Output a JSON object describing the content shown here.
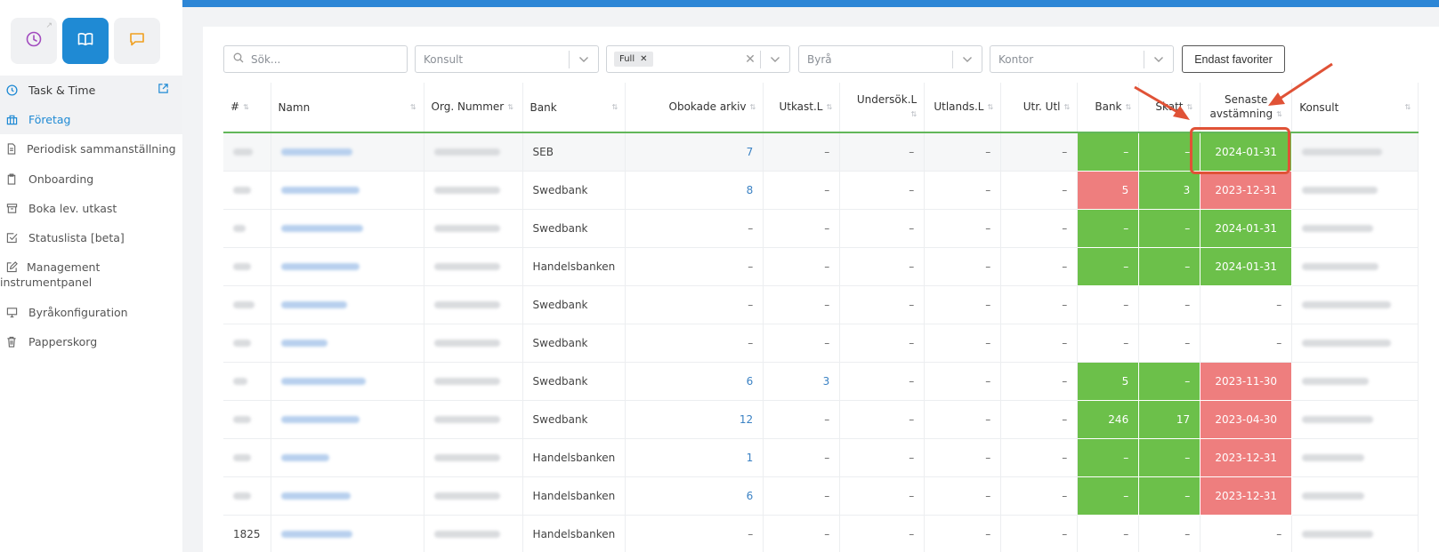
{
  "sidebar": {
    "top_icons": [
      "clock-icon",
      "book-icon",
      "chat-icon"
    ],
    "items": [
      {
        "label": "Task & Time",
        "icon": "clock-icon",
        "external": true
      },
      {
        "label": "Företag",
        "icon": "building-icon"
      },
      {
        "label": "Periodisk sammanställning",
        "icon": "document-icon"
      },
      {
        "label": "Onboarding",
        "icon": "clipboard-icon"
      },
      {
        "label": "Boka lev. utkast",
        "icon": "archive-icon"
      },
      {
        "label": "Statuslista [beta]",
        "icon": "checkbox-icon"
      },
      {
        "label": "Management instrumentpanel",
        "icon": "edit-icon"
      },
      {
        "label": "Byråkonfiguration",
        "icon": "monitor-icon"
      },
      {
        "label": "Papperskorg",
        "icon": "trash-icon"
      }
    ]
  },
  "filters": {
    "search_placeholder": "Sök...",
    "konsult_placeholder": "Konsult",
    "full_chip": "Full",
    "byra_placeholder": "Byrå",
    "kontor_placeholder": "Kontor",
    "favorites_button": "Endast favoriter"
  },
  "table": {
    "headers": {
      "num": "#",
      "namn": "Namn",
      "org": "Org. Nummer",
      "bank": "Bank",
      "obokade": "Obokade arkiv",
      "utkast": "Utkast.L",
      "undersok": "Undersök.L",
      "utlands": "Utlands.L",
      "utrutl": "Utr. Utl",
      "bank2": "Bank",
      "skatt": "Skatt",
      "senaste1": "Senaste",
      "senaste2": "avstämning",
      "konsult": "Konsult"
    },
    "rows": [
      {
        "bank": "SEB",
        "obokade": "7",
        "utkast": "–",
        "undersok": "–",
        "utlands": "–",
        "utrutl": "–",
        "bankv": "–",
        "skatt": "–",
        "senaste": "2024-01-31",
        "bank_status": "green",
        "skatt_status": "green",
        "date_status": "green"
      },
      {
        "bank": "Swedbank",
        "obokade": "8",
        "utkast": "–",
        "undersok": "–",
        "utlands": "–",
        "utrutl": "–",
        "bankv": "5",
        "skatt": "3",
        "senaste": "2023-12-31",
        "bank_status": "red",
        "skatt_status": "green",
        "date_status": "red"
      },
      {
        "bank": "Swedbank",
        "obokade": "–",
        "utkast": "–",
        "undersok": "–",
        "utlands": "–",
        "utrutl": "–",
        "bankv": "–",
        "skatt": "–",
        "senaste": "2024-01-31",
        "bank_status": "green",
        "skatt_status": "green",
        "date_status": "green"
      },
      {
        "bank": "Handelsbanken",
        "obokade": "–",
        "utkast": "–",
        "undersok": "–",
        "utlands": "–",
        "utrutl": "–",
        "bankv": "–",
        "skatt": "–",
        "senaste": "2024-01-31",
        "bank_status": "green",
        "skatt_status": "green",
        "date_status": "green"
      },
      {
        "bank": "Swedbank",
        "obokade": "–",
        "utkast": "–",
        "undersok": "–",
        "utlands": "–",
        "utrutl": "–",
        "bankv": "–",
        "skatt": "–",
        "senaste": "–",
        "bank_status": "none",
        "skatt_status": "none",
        "date_status": "none"
      },
      {
        "bank": "Swedbank",
        "obokade": "–",
        "utkast": "–",
        "undersok": "–",
        "utlands": "–",
        "utrutl": "–",
        "bankv": "–",
        "skatt": "–",
        "senaste": "–",
        "bank_status": "none",
        "skatt_status": "none",
        "date_status": "none"
      },
      {
        "bank": "Swedbank",
        "obokade": "6",
        "utkast": "3",
        "undersok": "–",
        "utlands": "–",
        "utrutl": "–",
        "bankv": "5",
        "skatt": "–",
        "senaste": "2023-11-30",
        "bank_status": "green",
        "skatt_status": "green",
        "date_status": "red"
      },
      {
        "bank": "Swedbank",
        "obokade": "12",
        "utkast": "–",
        "undersok": "–",
        "utlands": "–",
        "utrutl": "–",
        "bankv": "246",
        "skatt": "17",
        "senaste": "2023-04-30",
        "bank_status": "green",
        "skatt_status": "green",
        "date_status": "red"
      },
      {
        "bank": "Handelsbanken",
        "obokade": "1",
        "utkast": "–",
        "undersok": "–",
        "utlands": "–",
        "utrutl": "–",
        "bankv": "–",
        "skatt": "–",
        "senaste": "2023-12-31",
        "bank_status": "green",
        "skatt_status": "green",
        "date_status": "red"
      },
      {
        "bank": "Handelsbanken",
        "obokade": "6",
        "utkast": "–",
        "undersok": "–",
        "utlands": "–",
        "utrutl": "–",
        "bankv": "–",
        "skatt": "–",
        "senaste": "2023-12-31",
        "bank_status": "green",
        "skatt_status": "green",
        "date_status": "red"
      },
      {
        "num": "1825",
        "bank": "Handelsbanken",
        "obokade": "–",
        "utkast": "–",
        "undersok": "–",
        "utlands": "–",
        "utrutl": "–",
        "bankv": "–",
        "skatt": "–",
        "senaste": "–",
        "bank_status": "none",
        "skatt_status": "none",
        "date_status": "none"
      }
    ]
  },
  "colors": {
    "accent": "#1f8ad4",
    "green": "#6cc04a",
    "red": "#ee7e7e",
    "annotation": "#e05236"
  }
}
